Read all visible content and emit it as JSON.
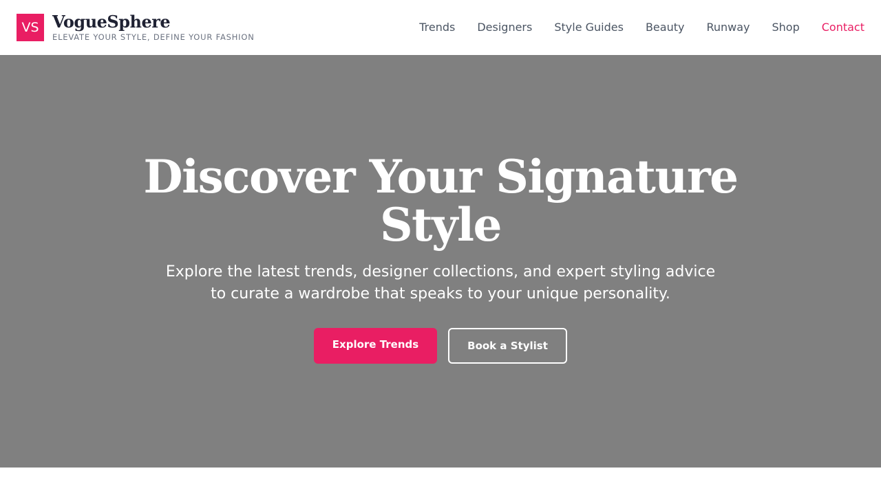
{
  "header": {
    "logo_mark": "VS",
    "brand_name": "VogueSphere",
    "tagline": "ELEVATE YOUR STYLE, DEFINE YOUR FASHION",
    "nav": [
      {
        "label": "Trends"
      },
      {
        "label": "Designers"
      },
      {
        "label": "Style Guides"
      },
      {
        "label": "Beauty"
      },
      {
        "label": "Runway"
      },
      {
        "label": "Shop"
      },
      {
        "label": "Contact",
        "active": true
      }
    ]
  },
  "hero": {
    "title": "Discover Your Signature Style",
    "subtitle": "Explore the latest trends, designer collections, and expert styling advice to curate a wardrobe that speaks to your unique personality.",
    "primary_cta": "Explore Trends",
    "secondary_cta": "Book a Stylist"
  },
  "colors": {
    "accent": "#e91e63",
    "hero_background": "#808080",
    "nav_text": "#4b5563",
    "brand_text": "#1f2233"
  }
}
